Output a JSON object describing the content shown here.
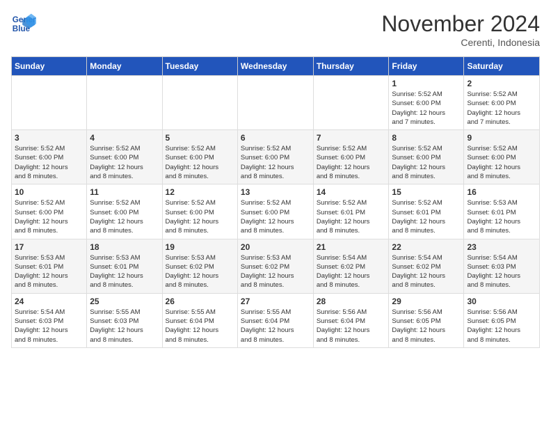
{
  "logo": {
    "line1": "General",
    "line2": "Blue"
  },
  "title": "November 2024",
  "subtitle": "Cerenti, Indonesia",
  "headers": [
    "Sunday",
    "Monday",
    "Tuesday",
    "Wednesday",
    "Thursday",
    "Friday",
    "Saturday"
  ],
  "weeks": [
    [
      {
        "day": "",
        "info": ""
      },
      {
        "day": "",
        "info": ""
      },
      {
        "day": "",
        "info": ""
      },
      {
        "day": "",
        "info": ""
      },
      {
        "day": "",
        "info": ""
      },
      {
        "day": "1",
        "info": "Sunrise: 5:52 AM\nSunset: 6:00 PM\nDaylight: 12 hours\nand 7 minutes."
      },
      {
        "day": "2",
        "info": "Sunrise: 5:52 AM\nSunset: 6:00 PM\nDaylight: 12 hours\nand 7 minutes."
      }
    ],
    [
      {
        "day": "3",
        "info": "Sunrise: 5:52 AM\nSunset: 6:00 PM\nDaylight: 12 hours\nand 8 minutes."
      },
      {
        "day": "4",
        "info": "Sunrise: 5:52 AM\nSunset: 6:00 PM\nDaylight: 12 hours\nand 8 minutes."
      },
      {
        "day": "5",
        "info": "Sunrise: 5:52 AM\nSunset: 6:00 PM\nDaylight: 12 hours\nand 8 minutes."
      },
      {
        "day": "6",
        "info": "Sunrise: 5:52 AM\nSunset: 6:00 PM\nDaylight: 12 hours\nand 8 minutes."
      },
      {
        "day": "7",
        "info": "Sunrise: 5:52 AM\nSunset: 6:00 PM\nDaylight: 12 hours\nand 8 minutes."
      },
      {
        "day": "8",
        "info": "Sunrise: 5:52 AM\nSunset: 6:00 PM\nDaylight: 12 hours\nand 8 minutes."
      },
      {
        "day": "9",
        "info": "Sunrise: 5:52 AM\nSunset: 6:00 PM\nDaylight: 12 hours\nand 8 minutes."
      }
    ],
    [
      {
        "day": "10",
        "info": "Sunrise: 5:52 AM\nSunset: 6:00 PM\nDaylight: 12 hours\nand 8 minutes."
      },
      {
        "day": "11",
        "info": "Sunrise: 5:52 AM\nSunset: 6:00 PM\nDaylight: 12 hours\nand 8 minutes."
      },
      {
        "day": "12",
        "info": "Sunrise: 5:52 AM\nSunset: 6:00 PM\nDaylight: 12 hours\nand 8 minutes."
      },
      {
        "day": "13",
        "info": "Sunrise: 5:52 AM\nSunset: 6:00 PM\nDaylight: 12 hours\nand 8 minutes."
      },
      {
        "day": "14",
        "info": "Sunrise: 5:52 AM\nSunset: 6:01 PM\nDaylight: 12 hours\nand 8 minutes."
      },
      {
        "day": "15",
        "info": "Sunrise: 5:52 AM\nSunset: 6:01 PM\nDaylight: 12 hours\nand 8 minutes."
      },
      {
        "day": "16",
        "info": "Sunrise: 5:53 AM\nSunset: 6:01 PM\nDaylight: 12 hours\nand 8 minutes."
      }
    ],
    [
      {
        "day": "17",
        "info": "Sunrise: 5:53 AM\nSunset: 6:01 PM\nDaylight: 12 hours\nand 8 minutes."
      },
      {
        "day": "18",
        "info": "Sunrise: 5:53 AM\nSunset: 6:01 PM\nDaylight: 12 hours\nand 8 minutes."
      },
      {
        "day": "19",
        "info": "Sunrise: 5:53 AM\nSunset: 6:02 PM\nDaylight: 12 hours\nand 8 minutes."
      },
      {
        "day": "20",
        "info": "Sunrise: 5:53 AM\nSunset: 6:02 PM\nDaylight: 12 hours\nand 8 minutes."
      },
      {
        "day": "21",
        "info": "Sunrise: 5:54 AM\nSunset: 6:02 PM\nDaylight: 12 hours\nand 8 minutes."
      },
      {
        "day": "22",
        "info": "Sunrise: 5:54 AM\nSunset: 6:02 PM\nDaylight: 12 hours\nand 8 minutes."
      },
      {
        "day": "23",
        "info": "Sunrise: 5:54 AM\nSunset: 6:03 PM\nDaylight: 12 hours\nand 8 minutes."
      }
    ],
    [
      {
        "day": "24",
        "info": "Sunrise: 5:54 AM\nSunset: 6:03 PM\nDaylight: 12 hours\nand 8 minutes."
      },
      {
        "day": "25",
        "info": "Sunrise: 5:55 AM\nSunset: 6:03 PM\nDaylight: 12 hours\nand 8 minutes."
      },
      {
        "day": "26",
        "info": "Sunrise: 5:55 AM\nSunset: 6:04 PM\nDaylight: 12 hours\nand 8 minutes."
      },
      {
        "day": "27",
        "info": "Sunrise: 5:55 AM\nSunset: 6:04 PM\nDaylight: 12 hours\nand 8 minutes."
      },
      {
        "day": "28",
        "info": "Sunrise: 5:56 AM\nSunset: 6:04 PM\nDaylight: 12 hours\nand 8 minutes."
      },
      {
        "day": "29",
        "info": "Sunrise: 5:56 AM\nSunset: 6:05 PM\nDaylight: 12 hours\nand 8 minutes."
      },
      {
        "day": "30",
        "info": "Sunrise: 5:56 AM\nSunset: 6:05 PM\nDaylight: 12 hours\nand 8 minutes."
      }
    ]
  ]
}
